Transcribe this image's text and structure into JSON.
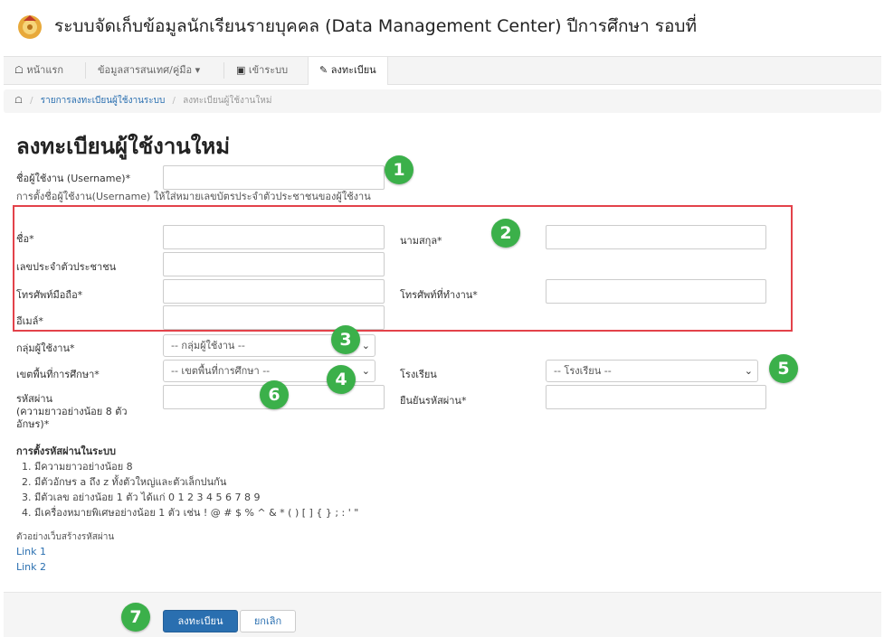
{
  "header": {
    "title": "ระบบจัดเก็บข้อมูลนักเรียนรายบุคคล (Data Management Center) ปีการศึกษา รอบที่"
  },
  "nav": {
    "home": "หน้าแรก",
    "info": "ข้อมูลสารสนเทศ/คู่มือ",
    "login": "เข้าระบบ",
    "register": "ลงทะเบียน"
  },
  "breadcrumb": {
    "list": "รายการลงทะเบียนผู้ใช้งานระบบ",
    "current": "ลงทะเบียนผู้ใช้งานใหม่"
  },
  "page_title": "ลงทะเบียนผู้ใช้งานใหม่",
  "form": {
    "username_label": "ชื่อผู้ใช้งาน (Username)*",
    "username_hint": "การตั้งชื่อผู้ใช้งาน(Username) ให้ใส่หมายเลขบัตรประจำตัวประชาชนของผู้ใช้งาน",
    "firstname_label": "ชื่อ*",
    "lastname_label": "นามสกุล*",
    "idcard_label": "เลขประจำตัวประชาชน",
    "mobile_label": "โทรศัพท์มือถือ*",
    "workphone_label": "โทรศัพท์ที่ทำงาน*",
    "email_label": "อีเมล์*",
    "usergroup_label": "กลุ่มผู้ใช้งาน*",
    "usergroup_value": "-- กลุ่มผู้ใช้งาน --",
    "area_label": "เขตพื้นที่การศึกษา*",
    "area_value": "-- เขตพื้นที่การศึกษา --",
    "school_label": "โรงเรียน",
    "school_value": "-- โรงเรียน --",
    "password_label_1": "รหัสผ่าน",
    "password_label_2": "(ความยาวอย่างน้อย 8 ตัว",
    "password_label_3": "อักษร)*",
    "confirm_label": "ยืนยันรหัสผ่าน*"
  },
  "password_rules": {
    "title": "การตั้งรหัสผ่านในระบบ",
    "items": [
      "1. มีความยาวอย่างน้อย 8",
      "2. มีตัวอักษร a ถึง z ทั้งตัวใหญ่และตัวเล็กปนกัน",
      "3. มีตัวเลข อย่างน้อย 1 ตัว ได้แก่ 0 1 2 3 4 5 6 7 8 9",
      "4. มีเครื่องหมายพิเศษอย่างน้อย 1 ตัว เช่น ! @ # $ % ^ & * ( ) [ ] { } ; : ' \""
    ],
    "examples_label": "ตัวอย่างเว็บสร้างรหัสผ่าน",
    "link1": "Link 1",
    "link2": "Link 2"
  },
  "buttons": {
    "submit": "ลงทะเบียน",
    "cancel": "ยกเลิก"
  },
  "badges": [
    "1",
    "2",
    "3",
    "4",
    "5",
    "6",
    "7"
  ],
  "colors": {
    "accent": "#2a6fb0",
    "highlight": "#e3424a",
    "badge": "#3bb04a"
  }
}
